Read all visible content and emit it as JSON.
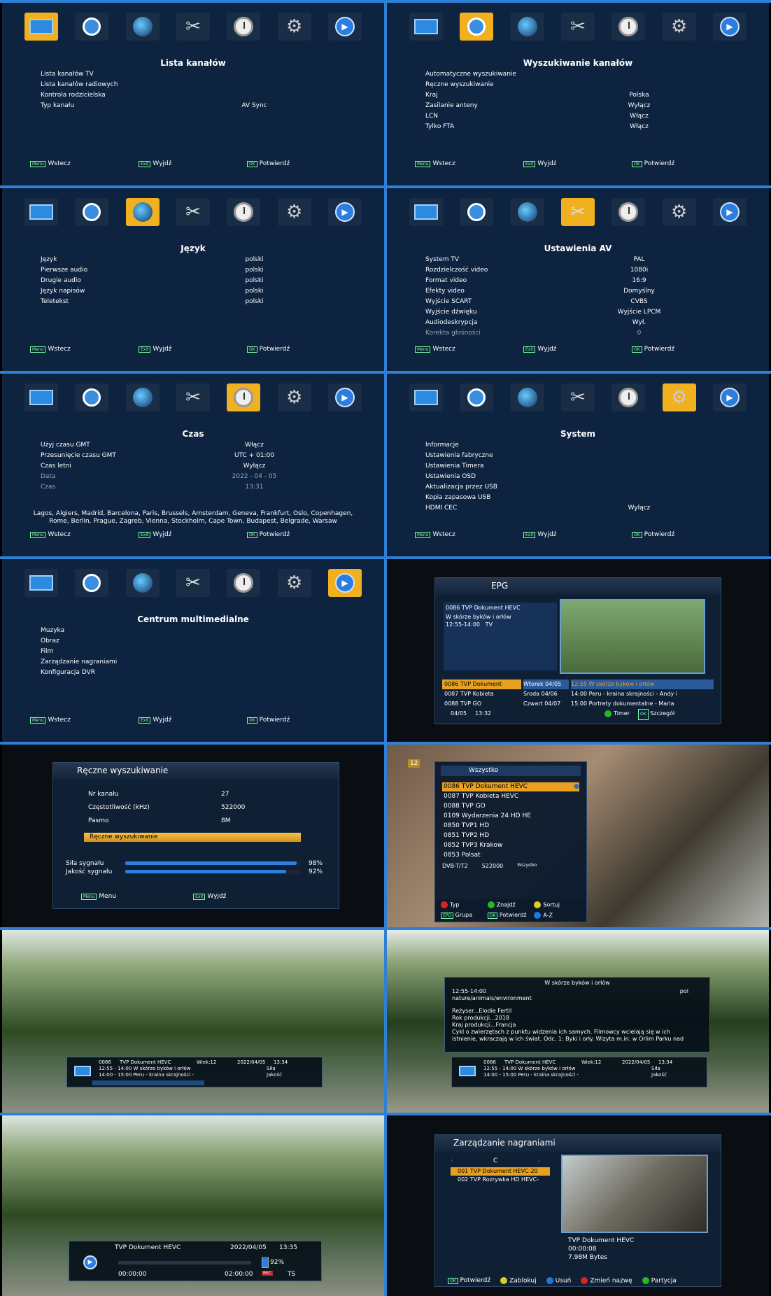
{
  "footer": {
    "back": "Wstecz",
    "exit": "Wyjdź",
    "confirm": "Potwierdź",
    "menu_key": "Menu",
    "exit_key": "Exit",
    "ok_key": "OK"
  },
  "p1": {
    "title": "Lista kanałów",
    "rows": [
      {
        "k": "Lista kanałów TV",
        "v": ""
      },
      {
        "k": "Lista kanałów radiowych",
        "v": ""
      },
      {
        "k": "Kontrola rodzicielska",
        "v": ""
      },
      {
        "k": "Typ kanału",
        "v": "AV Sync"
      }
    ]
  },
  "p2": {
    "title": "Wyszukiwanie kanałów",
    "rows": [
      {
        "k": "Automatyczne wyszukiwanie",
        "v": ""
      },
      {
        "k": "Ręczne wyszukiwanie",
        "v": ""
      },
      {
        "k": "Kraj",
        "v": "Polska"
      },
      {
        "k": "Zasilanie anteny",
        "v": "Wyłącz"
      },
      {
        "k": "LCN",
        "v": "Włącz"
      },
      {
        "k": "Tylko FTA",
        "v": "Włącz"
      }
    ]
  },
  "p3": {
    "title": "Język",
    "rows": [
      {
        "k": "Język",
        "v": "polski"
      },
      {
        "k": "Pierwsze audio",
        "v": "polski"
      },
      {
        "k": "Drugie audio",
        "v": "polski"
      },
      {
        "k": "Język napisów",
        "v": "polski"
      },
      {
        "k": "Teletekst",
        "v": "polski"
      }
    ]
  },
  "p4": {
    "title": "Ustawienia AV",
    "rows": [
      {
        "k": "System TV",
        "v": "PAL"
      },
      {
        "k": "Rozdzielczość video",
        "v": "1080i"
      },
      {
        "k": "Format video",
        "v": "16:9"
      },
      {
        "k": "Efekty video",
        "v": "Domyślny"
      },
      {
        "k": "Wyjście SCART",
        "v": "CVBS"
      },
      {
        "k": "Wyjście dźwięku",
        "v": "Wyjście LPCM"
      },
      {
        "k": "Audiodeskrypcja",
        "v": "Wył."
      },
      {
        "k": "Korekta głośności",
        "v": "0"
      }
    ]
  },
  "p5": {
    "title": "Czas",
    "rows": [
      {
        "k": "Użyj czasu GMT",
        "v": "Włącz"
      },
      {
        "k": "Przesunięcie czasu GMT",
        "v": "UTC + 01:00"
      },
      {
        "k": "Czas letni",
        "v": "Wyłącz"
      },
      {
        "k": "Data",
        "v": "2022 - 04 - 05"
      },
      {
        "k": "Czas",
        "v": "13:31"
      }
    ],
    "cities": "Lagos, Algiers, Madrid, Barcelona, Paris, Brussels, Amsterdam, Geneva, Frankfurt, Oslo, Copenhagen, Rome, Berlin, Prague, Zagreb, Vienna, Stockholm, Cape Town, Budapest, Belgrade, Warsaw"
  },
  "p6": {
    "title": "System",
    "rows": [
      {
        "k": "Informacje",
        "v": ""
      },
      {
        "k": "Ustawienia fabryczne",
        "v": ""
      },
      {
        "k": "Ustawienia Timera",
        "v": ""
      },
      {
        "k": "Ustawienia OSD",
        "v": ""
      },
      {
        "k": "Aktualizacja przez USB",
        "v": ""
      },
      {
        "k": "Kopia zapasowa USB",
        "v": ""
      },
      {
        "k": "HDMI CEC",
        "v": "Wyłącz"
      }
    ]
  },
  "p7": {
    "title": "Centrum multimedialne",
    "rows": [
      {
        "k": "Muzyka",
        "v": ""
      },
      {
        "k": "Obraz",
        "v": ""
      },
      {
        "k": "Film",
        "v": ""
      },
      {
        "k": "Zarządzanie nagraniami",
        "v": ""
      },
      {
        "k": "Konfiguracja DVR",
        "v": ""
      }
    ]
  },
  "epg": {
    "title": "EPG",
    "info1": "0086 TVP Dokument HEVC",
    "info2": "W skórze byków i orłów",
    "info3": "12:55-14:00",
    "info3b": "TV",
    "rows": [
      {
        "ch": "0086  TVP Dokument",
        "day": "Wtorek 04/05",
        "prog": "12:55  W skórze byków i orłów"
      },
      {
        "ch": "0087  TVP Kobieta",
        "day": "Środa  04/06",
        "prog": "14:00   Peru - kraina skrajności - Andy i"
      },
      {
        "ch": "0088  TVP GO",
        "day": "Czwart 04/07",
        "prog": "15:00   Portrety dokumentalne - Maria"
      }
    ],
    "date": "04/05",
    "time": "13:32",
    "timer": "Timer",
    "details": "Szczegół"
  },
  "manual": {
    "title": "Ręczne wyszukiwanie",
    "rows": [
      {
        "k": "Nr kanału",
        "v": "27"
      },
      {
        "k": "Częstotliwość (kHz)",
        "v": "522000"
      },
      {
        "k": "Pasmo",
        "v": "8M"
      }
    ],
    "button": "Ręczne wyszukiwanie",
    "signal_strength": "Siła sygnału",
    "signal_quality": "Jakość sygnału",
    "strength_pct": "98%",
    "quality_pct": "92%",
    "strength": 0.98,
    "quality": 0.92,
    "menu": "Menu",
    "exit": "Wyjdź"
  },
  "chanlist": {
    "title": "Wszystko",
    "items": [
      "0086  TVP Dokument HEVC",
      "0087  TVP Kobieta HEVC",
      "0088  TVP GO",
      "0109  Wydarzenia 24 HD HE",
      "0850  TVP1 HD",
      "0851  TVP2 HD",
      "0852  TVP3 Krakow",
      "0853  Polsat"
    ],
    "sys": "DVB-T/T2",
    "freq": "522000",
    "group": "Wszystko",
    "btn": [
      "Typ",
      "Znajdź",
      "Sortuj",
      "Grupa",
      "Potwierdź",
      "A-Z"
    ],
    "age": "12"
  },
  "infobar": {
    "ch": "0086",
    "name": "TVP Dokument HEVC",
    "age": "Wiek:12",
    "date": "2022/04/05",
    "time": "13:34",
    "now": "12:55 - 14:00   W skórze byków i orłów",
    "next": "14:00 - 15:00   Peru - kraina skrajności -",
    "sila": "Siła",
    "jakosc": "Jakość"
  },
  "detail": {
    "title": "W skórze byków i orłów",
    "time": "12:55-14:00",
    "lang": "pol",
    "genre": "nature/animals/environment",
    "l1": "Reżyser...Elodie Fertil",
    "l2": "Rok produkcji...2018",
    "l3": "Kraj produkcji...Francja",
    "l4": "Cykl o zwierzętach z punktu widzenia ich samych. Filmowcy wcielają się w ich",
    "l5": "istnienie, wkraczają w ich świat. Odc. 1: Byki i orły. Wizyta m.in. w Orlim Parku nad"
  },
  "playback": {
    "name": "TVP Dokument HEVC",
    "date": "2022/04/05",
    "time": "13:35",
    "start": "00:00:00",
    "end": "02:00:00",
    "pct": "92%",
    "ts": "TS",
    "rec": "REC",
    "progress": 0.0
  },
  "recmgr": {
    "title": "Zarządzanie nagraniami",
    "folder": "C",
    "items": [
      "001 TVP Dokument HEVC-20",
      "002 TVP Rozrywka HD HEVC-"
    ],
    "name": "TVP Dokument HEVC",
    "dur": "00:00:08",
    "size": "7.98M Bytes",
    "btn": [
      "Potwierdź",
      "Zablokuj",
      "Usuń",
      "Zmień nazwę",
      "Partycja"
    ]
  }
}
